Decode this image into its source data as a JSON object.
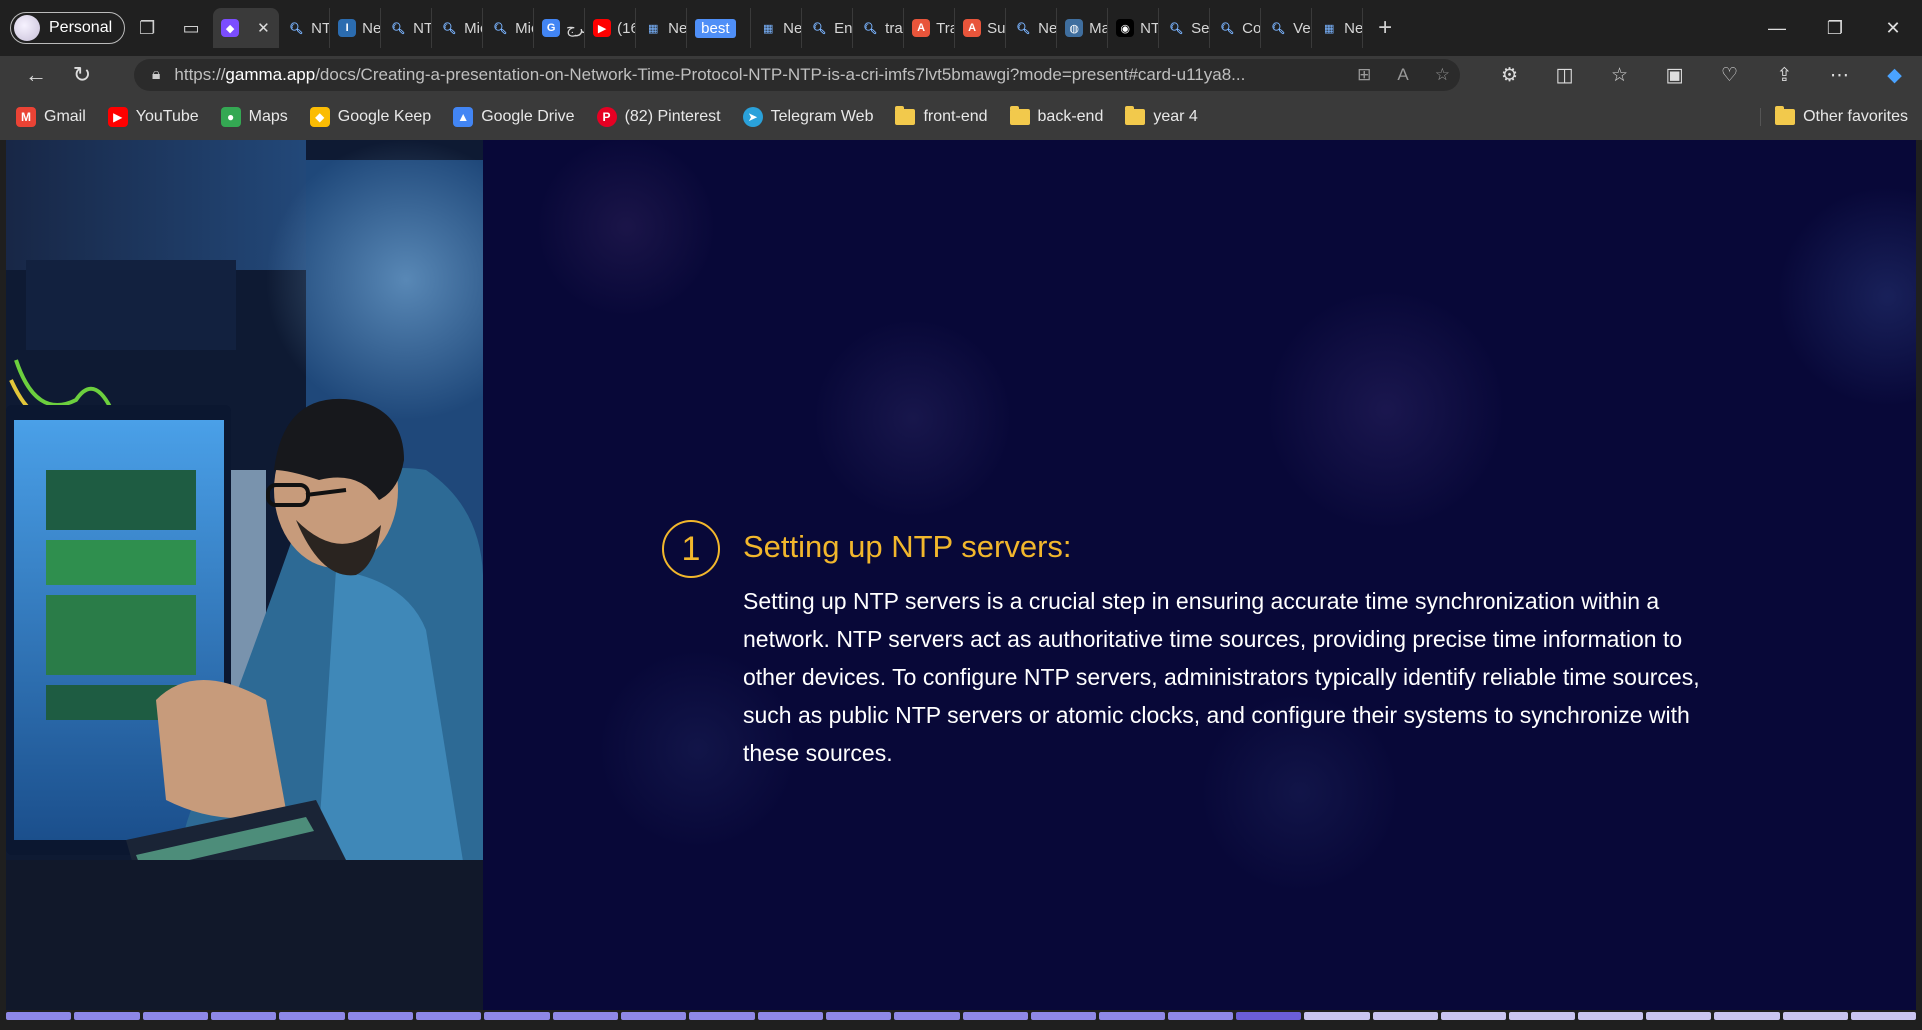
{
  "browser": {
    "profile_label": "Personal",
    "tabs": [
      {
        "label": "",
        "icon": "gamma-icon",
        "active": true
      },
      {
        "label": "NTI",
        "icon": "search-icon"
      },
      {
        "label": "Net",
        "icon": "cursor-icon"
      },
      {
        "label": "NTI",
        "icon": "search-icon"
      },
      {
        "label": "Mic",
        "icon": "search-icon"
      },
      {
        "label": "Mic",
        "icon": "search-icon"
      },
      {
        "label": "ترج",
        "icon": "translate-icon"
      },
      {
        "label": "(16",
        "icon": "youtube-icon"
      },
      {
        "label": "Ne",
        "icon": "newtab-icon"
      },
      {
        "label": "best",
        "icon": ""
      },
      {
        "label": "Nev",
        "icon": "newtab-icon"
      },
      {
        "label": "Ens",
        "icon": "search-icon"
      },
      {
        "label": "trai",
        "icon": "search-icon"
      },
      {
        "label": "Tra",
        "icon": "reverso-icon"
      },
      {
        "label": "Sur",
        "icon": "reverso-icon"
      },
      {
        "label": "Ne",
        "icon": "search-icon"
      },
      {
        "label": "Ma",
        "icon": "globe-icon"
      },
      {
        "label": "NTI",
        "icon": "chatbot-icon"
      },
      {
        "label": "Set",
        "icon": "search-icon"
      },
      {
        "label": "Co",
        "icon": "search-icon"
      },
      {
        "label": "Ver",
        "icon": "search-icon"
      },
      {
        "label": "Ne",
        "icon": "newtab-icon"
      }
    ],
    "url_prefix": "https://",
    "url_domain": "gamma.app",
    "url_path": "/docs/Creating-a-presentation-on-Network-Time-Protocol-NTP-NTP-is-a-cri-imfs7lvt5bmawgi?mode=present#card-u11ya8...",
    "bookmarks": [
      {
        "label": "Gmail",
        "icon": "gmail-icon",
        "color": "#ea4335"
      },
      {
        "label": "YouTube",
        "icon": "youtube-icon",
        "color": "#ff0000"
      },
      {
        "label": "Maps",
        "icon": "maps-icon",
        "color": "#34a853"
      },
      {
        "label": "Google Keep",
        "icon": "keep-icon",
        "color": "#fbbc04"
      },
      {
        "label": "Google Drive",
        "icon": "drive-icon",
        "color": "#4285f4"
      },
      {
        "label": "(82) Pinterest",
        "icon": "pinterest-icon",
        "color": "#e60023"
      },
      {
        "label": "Telegram Web",
        "icon": "telegram-icon",
        "color": "#2aa1da"
      },
      {
        "label": "front-end",
        "icon": "folder-icon"
      },
      {
        "label": "back-end",
        "icon": "folder-icon"
      },
      {
        "label": "year 4",
        "icon": "folder-icon"
      }
    ],
    "other_favorites": "Other favorites"
  },
  "slide": {
    "number": "1",
    "heading": "Setting up NTP servers:",
    "body": "Setting up NTP servers is a crucial step in ensuring accurate time synchronization within a network. NTP servers act as authoritative time sources, providing precise time information to other devices. To configure NTP servers, administrators typically identify reliable time sources, such as public NTP servers or atomic clocks, and configure their systems to synchronize with these sources.",
    "accent_color": "#f2b72c",
    "background_color": "#080838"
  },
  "progress": {
    "current": 19,
    "total": 28
  }
}
